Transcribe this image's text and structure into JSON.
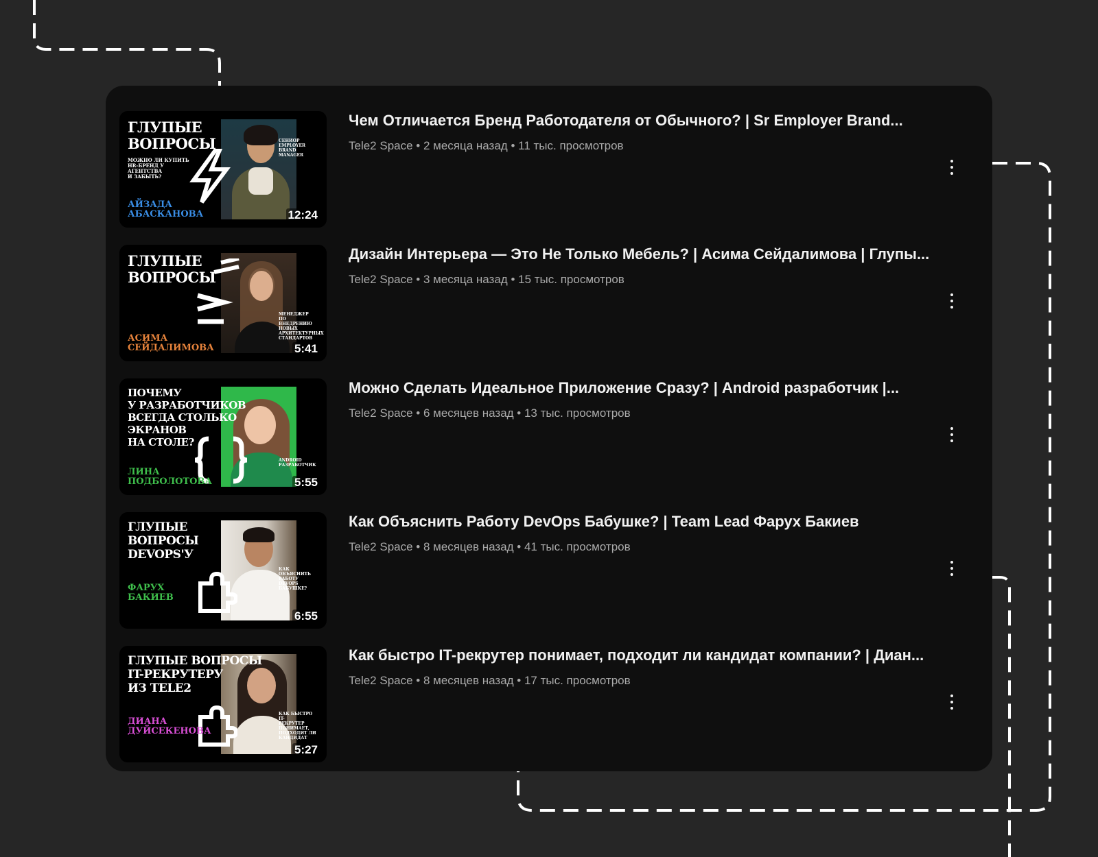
{
  "videos": [
    {
      "title": "Чем Отличается Бренд Работодателя от Обычного? | Sr Employer Brand...",
      "channel": "Tele2 Space",
      "meta": "Tele2 Space • 2 месяца назад • 11 тыс. просмотров",
      "duration": "12:24",
      "thumb": {
        "title": "ГЛУПЫЕ\nВОПРОСЫ",
        "subtitle": "МОЖНО ЛИ КУПИТЬ\nHR-БРЕНД У АГЕНТСТВА\nИ ЗАБЫТЬ?",
        "name": "АЙЗАДА\nАБАСКАНОВА",
        "name_color": "#3a8ee6",
        "note": "СЕНИОР\nEMPLOYER\nBRAND\nMANAGER",
        "glyph": "lightning-icon"
      }
    },
    {
      "title": "Дизайн Интерьера — Это Не Только Мебель? | Асима Сейдалимова | Глупы...",
      "channel": "Tele2 Space",
      "meta": "Tele2 Space • 3 месяца назад • 15 тыс. просмотров",
      "duration": "5:41",
      "thumb": {
        "title": "ГЛУПЫЕ\nВОПРОСЫ",
        "subtitle": "",
        "name": "АСИМА\nСЕЙДАЛИМОВА",
        "name_color": "#e8843c",
        "note": "МЕНЕДЖЕР\nПО ВНЕДРЕНИЮ\nНОВЫХ\nАРХИТЕКТУРНЫХ\nСТАНДАРТОВ",
        "glyph": "stripes-icon"
      }
    },
    {
      "title": "Можно Сделать Идеальное Приложение Сразу? | Android разработчик |...",
      "channel": "Tele2 Space",
      "meta": "Tele2 Space • 6 месяцев назад • 13 тыс. просмотров",
      "duration": "5:55",
      "thumb": {
        "title": "ПОЧЕМУ\nУ РАЗРАБОТЧИКОВ\nВСЕГДА СТОЛЬКО\nЭКРАНОВ\nНА СТОЛЕ?",
        "subtitle": "",
        "name": "ЛИНА\nПОДБОЛОТОВА",
        "name_color": "#3fbf4c",
        "note": "ANDROID\nРАЗРАБОТЧИК",
        "glyph": "braces-icon"
      }
    },
    {
      "title": "Как Объяснить Работу DevOps Бабушке? | Team Lead Фарух Бакиев",
      "channel": "Tele2 Space",
      "meta": "Tele2 Space • 8 месяцев назад • 41 тыс. просмотров",
      "duration": "6:55",
      "thumb": {
        "title": "ГЛУПЫЕ\nВОПРОСЫ\nDEVOPS'У",
        "subtitle": "",
        "name": "ФАРУХ\nБАКИЕВ",
        "name_color": "#3fbf4c",
        "note": "КАК ОБЪЯСНИТЬ\nРАБОТУ\nDEVOPS\nБАБУШКЕ?",
        "glyph": "puzzle-icon"
      }
    },
    {
      "title": "Как быстро IT-рекрутер понимает, подходит ли кандидат компании? | Диан...",
      "channel": "Tele2 Space",
      "meta": "Tele2 Space • 8 месяцев назад • 17 тыс. просмотров",
      "duration": "5:27",
      "thumb": {
        "title": "ГЛУПЫЕ ВОПРОСЫ\nIT-РЕКРУТЕРУ\nИЗ TELE2",
        "subtitle": "",
        "name": "ДИАНА\nДУЙСЕКЕНОВА",
        "name_color": "#d94fd6",
        "note": "КАК БЫСТРО IT-\nРЕКРУТЕР\nПОНИМАЕТ,\nПОДХОДИТ ЛИ\nКАНДИДАТ",
        "glyph": "puzzle-icon"
      }
    }
  ],
  "colors": {
    "background": "#262626",
    "panel": "#0f0f0f",
    "title_text": "#f1f1f1",
    "meta_text": "#aaaaaa"
  }
}
